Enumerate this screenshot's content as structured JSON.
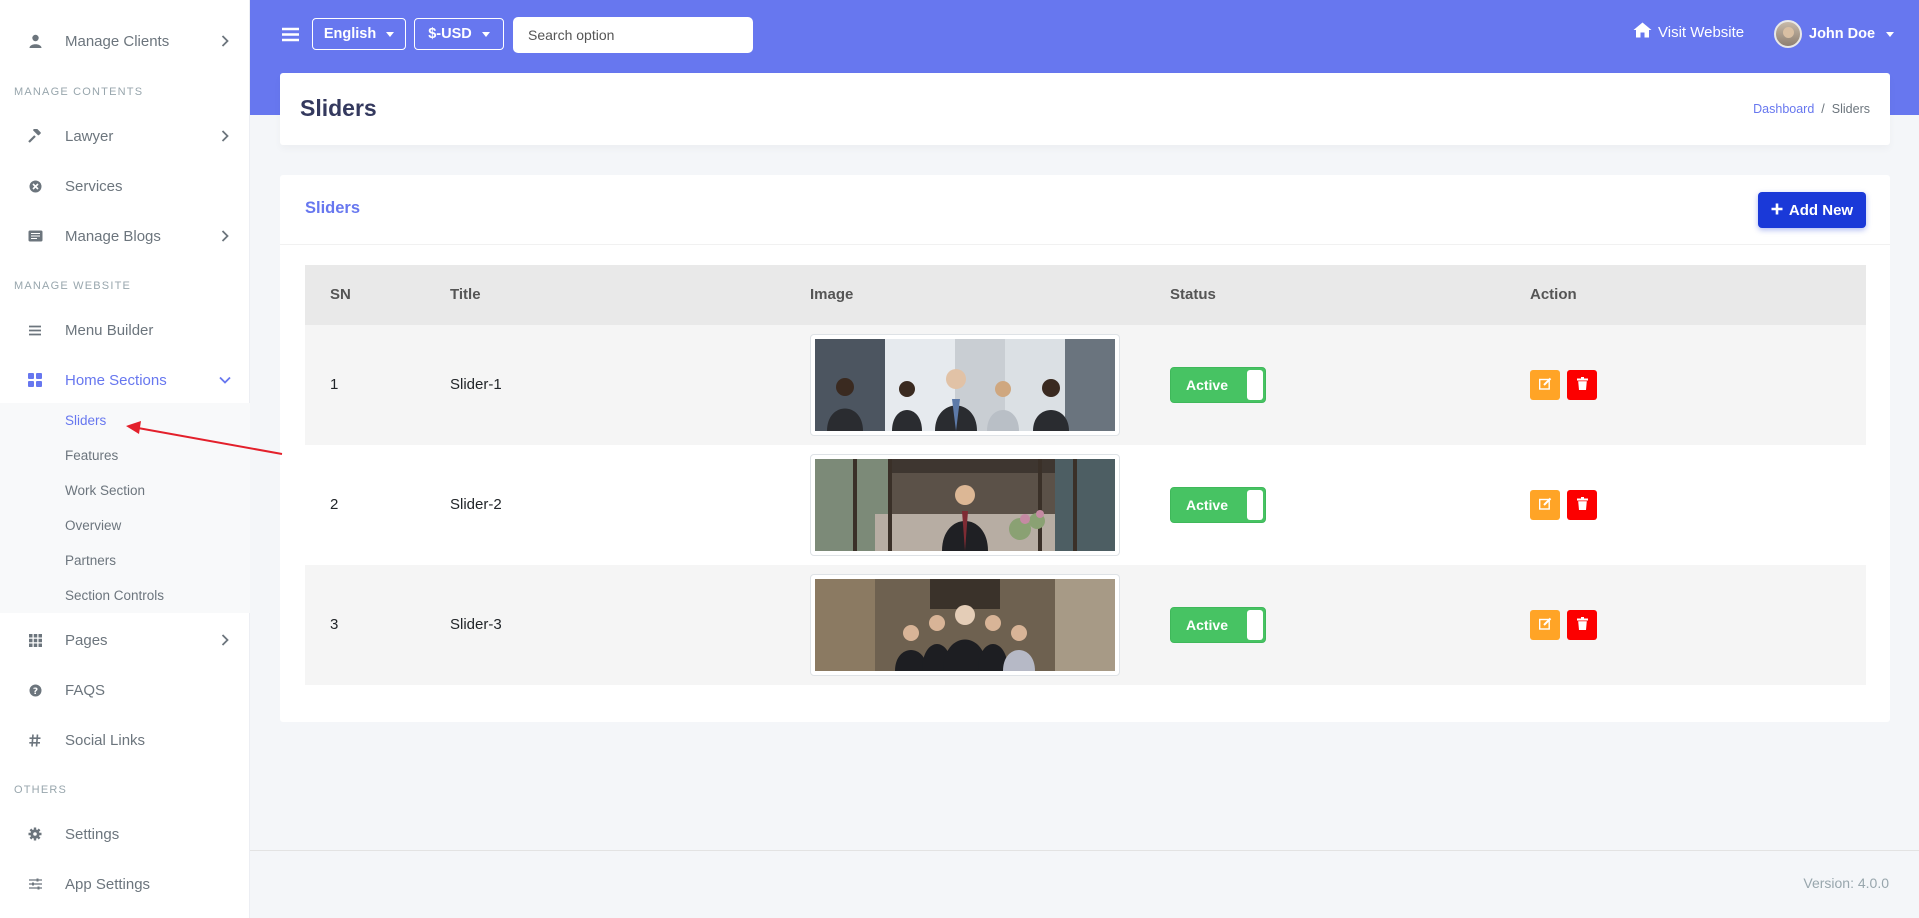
{
  "sidebar": {
    "manage_clients": "Manage Clients",
    "section_manage_contents": "MANAGE CONTENTS",
    "lawyer": "Lawyer",
    "services": "Services",
    "manage_blogs": "Manage Blogs",
    "section_manage_website": "MANAGE WEBSITE",
    "menu_builder": "Menu Builder",
    "home_sections": "Home Sections",
    "sub_items": [
      "Sliders",
      "Features",
      "Work Section",
      "Overview",
      "Partners",
      "Section Controls"
    ],
    "pages": "Pages",
    "faqs": "FAQS",
    "social_links": "Social Links",
    "section_others": "OTHERS",
    "settings": "Settings",
    "app_settings": "App Settings"
  },
  "topbar": {
    "language": "English",
    "currency": "$-USD",
    "search_placeholder": "Search option",
    "visit_website": "Visit Website",
    "user_name": "John Doe"
  },
  "page": {
    "title": "Sliders",
    "breadcrumb_home": "Dashboard",
    "breadcrumb_sep": "/",
    "breadcrumb_current": "Sliders"
  },
  "card": {
    "title": "Sliders",
    "add_new": "Add New"
  },
  "table": {
    "headers": [
      "SN",
      "Title",
      "Image",
      "Status",
      "Action"
    ],
    "rows": [
      {
        "sn": "1",
        "title": "Slider-1",
        "status": "Active"
      },
      {
        "sn": "2",
        "title": "Slider-2",
        "status": "Active"
      },
      {
        "sn": "3",
        "title": "Slider-3",
        "status": "Active"
      }
    ]
  },
  "footer": {
    "version": "Version: 4.0.0"
  },
  "colors": {
    "primary": "#6777ef",
    "add_button": "#1a39d8",
    "success": "#47c363",
    "warning": "#ffa426",
    "danger": "#fc0000",
    "annotation_arrow": "#e3202b"
  }
}
